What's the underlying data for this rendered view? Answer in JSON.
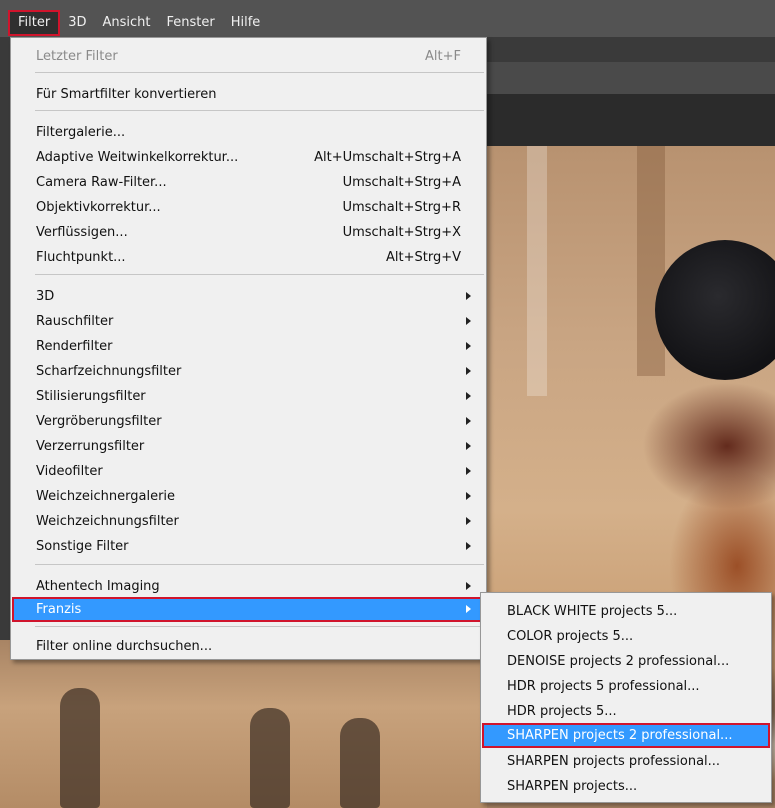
{
  "menubar": {
    "items": [
      "Filter",
      "3D",
      "Ansicht",
      "Fenster",
      "Hilfe"
    ]
  },
  "filter_menu": {
    "last_filter": {
      "label": "Letzter Filter",
      "shortcut": "Alt+F"
    },
    "smartfilter": {
      "label": "Für Smartfilter konvertieren"
    },
    "group1": [
      {
        "label": "Filtergalerie...",
        "shortcut": ""
      },
      {
        "label": "Adaptive Weitwinkelkorrektur...",
        "shortcut": "Alt+Umschalt+Strg+A"
      },
      {
        "label": "Camera Raw-Filter...",
        "shortcut": "Umschalt+Strg+A"
      },
      {
        "label": "Objektivkorrektur...",
        "shortcut": "Umschalt+Strg+R"
      },
      {
        "label": "Verflüssigen...",
        "shortcut": "Umschalt+Strg+X"
      },
      {
        "label": "Fluchtpunkt...",
        "shortcut": "Alt+Strg+V"
      }
    ],
    "group2": [
      {
        "label": "3D"
      },
      {
        "label": "Rauschfilter"
      },
      {
        "label": "Renderfilter"
      },
      {
        "label": "Scharfzeichnungsfilter"
      },
      {
        "label": "Stilisierungsfilter"
      },
      {
        "label": "Vergröberungsfilter"
      },
      {
        "label": "Verzerrungsfilter"
      },
      {
        "label": "Videofilter"
      },
      {
        "label": "Weichzeichnergalerie"
      },
      {
        "label": "Weichzeichnungsfilter"
      },
      {
        "label": "Sonstige Filter"
      }
    ],
    "group3": [
      {
        "label": "Athentech Imaging"
      },
      {
        "label": "Franzis"
      }
    ],
    "browse_online": {
      "label": "Filter online durchsuchen..."
    }
  },
  "franzis_submenu": {
    "items": [
      "BLACK WHITE projects 5...",
      "COLOR projects 5...",
      "DENOISE projects 2 professional...",
      "HDR projects 5 professional...",
      "HDR projects 5...",
      "SHARPEN projects 2 professional...",
      "SHARPEN projects professional...",
      "SHARPEN projects..."
    ]
  },
  "colors": {
    "menubar_bg": "#535353",
    "menu_bg": "#f0f0f0",
    "highlight_bg": "#3399ff",
    "annotation_border": "#d0142c"
  }
}
